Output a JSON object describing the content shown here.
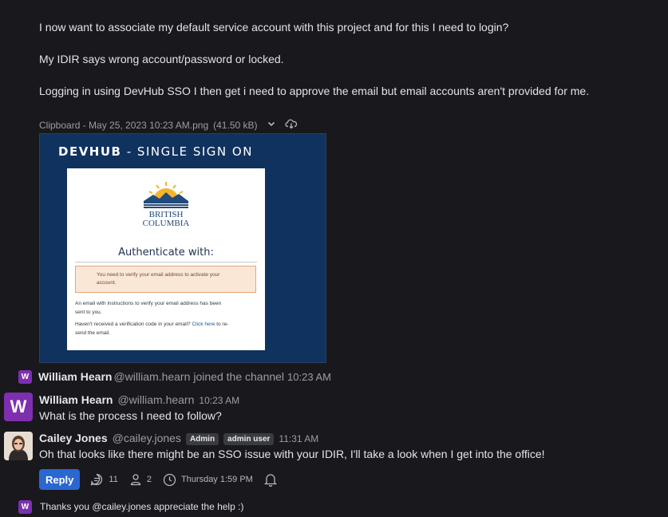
{
  "messages_top": {
    "line1": "I now want to associate my default service account with this project and for this I need to login?",
    "line2": "My IDIR says wrong account/password or locked.",
    "line3": "Logging in using DevHub SSO I then get i need to approve the email but email accounts aren't provided for me."
  },
  "attachment": {
    "filename": "Clipboard - May 25, 2023 10:23 AM.png",
    "size": "(41.50 kB)",
    "chevron_icon": "chevron-down-icon",
    "download_icon": "cloud-download-icon",
    "preview": {
      "title_bold": "DEVHUB",
      "title_rest": " - SINGLE SIGN ON",
      "brand_line1": "BRITISH",
      "brand_line2": "COLUMBIA",
      "heading": "Authenticate with:",
      "notice": "You need to verify your email address to activate your\naccount.",
      "body1": "An email with instructions to verify your email address has been\nsent to you.",
      "body2_prefix": "Haven't received a verification code in your email? ",
      "body2_link": "Click here",
      "body2_suffix": " to re-\nsend the email."
    }
  },
  "join_event": {
    "avatar_letter": "W",
    "name": "William Hearn",
    "handle": "@william.hearn",
    "text": "joined the channel",
    "time": "10:23 AM"
  },
  "post_william": {
    "avatar_letter": "W",
    "name": "William Hearn",
    "handle": "@william.hearn",
    "time": "10:23 AM",
    "text": "What is the process I need to follow?"
  },
  "post_cailey": {
    "name": "Cailey Jones",
    "handle": "@cailey.jones",
    "badge1": "Admin",
    "badge2": "admin user",
    "time": "11:31 AM",
    "text": "Oh that looks like there might be an SSO issue with your IDIR, I'll take a look when I get into the office!"
  },
  "thread_footer": {
    "reply_label": "Reply",
    "reply_count": "11",
    "participant_count": "2",
    "last_reply": "Thursday 1:59 PM"
  },
  "last_reply_preview": {
    "avatar_letter": "W",
    "text": "Thanks you @cailey.jones appreciate the help :)"
  },
  "colors": {
    "background": "#19191d",
    "accent": "#2b67d1",
    "avatar_purple": "#7e2fb0"
  }
}
